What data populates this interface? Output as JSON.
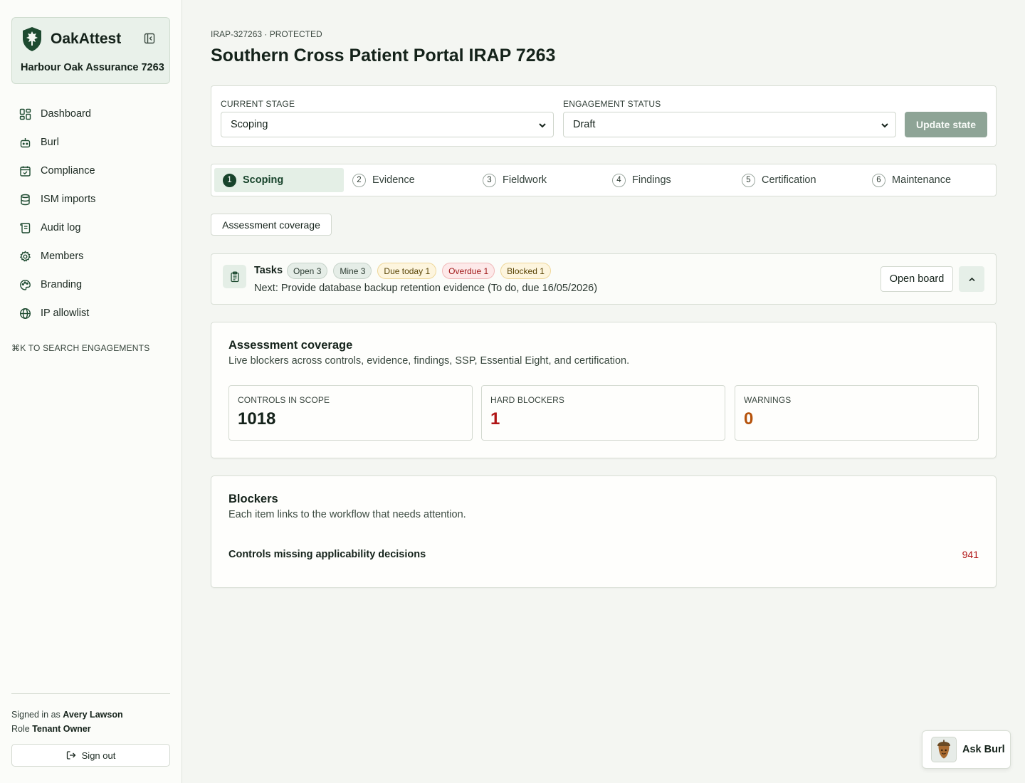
{
  "brand": {
    "name": "OakAttest",
    "tenant": "Harbour Oak Assurance 7263"
  },
  "nav": [
    {
      "label": "Dashboard",
      "icon": "dashboard-icon"
    },
    {
      "label": "Burl",
      "icon": "bot-icon"
    },
    {
      "label": "Compliance",
      "icon": "calendar-check-icon"
    },
    {
      "label": "ISM imports",
      "icon": "database-icon"
    },
    {
      "label": "Audit log",
      "icon": "scroll-icon"
    },
    {
      "label": "Members",
      "icon": "gear-icon"
    },
    {
      "label": "Branding",
      "icon": "palette-icon"
    },
    {
      "label": "IP allowlist",
      "icon": "globe-icon"
    }
  ],
  "search_hint": "⌘K TO SEARCH ENGAGEMENTS",
  "user": {
    "signed_in_prefix": "Signed in as",
    "name": "Avery Lawson",
    "role_prefix": "Role",
    "role": "Tenant Owner",
    "sign_out": "Sign out"
  },
  "header": {
    "eyebrow": "IRAP-327263 · PROTECTED",
    "title": "Southern Cross Patient Portal IRAP 7263"
  },
  "state": {
    "stage_label": "CURRENT STAGE",
    "stage_value": "Scoping",
    "status_label": "ENGAGEMENT STATUS",
    "status_value": "Draft",
    "update_button": "Update state"
  },
  "stages": [
    {
      "num": "1",
      "label": "Scoping",
      "active": true
    },
    {
      "num": "2",
      "label": "Evidence",
      "active": false
    },
    {
      "num": "3",
      "label": "Fieldwork",
      "active": false
    },
    {
      "num": "4",
      "label": "Findings",
      "active": false
    },
    {
      "num": "5",
      "label": "Certification",
      "active": false
    },
    {
      "num": "6",
      "label": "Maintenance",
      "active": false
    }
  ],
  "coverage_tab": "Assessment coverage",
  "tasks": {
    "title": "Tasks",
    "badges": [
      {
        "label": "Open 3",
        "kind": "neutral"
      },
      {
        "label": "Mine 3",
        "kind": "neutral"
      },
      {
        "label": "Due today 1",
        "kind": "due"
      },
      {
        "label": "Overdue 1",
        "kind": "overdue"
      },
      {
        "label": "Blocked 1",
        "kind": "blocked"
      }
    ],
    "next": "Next: Provide database backup retention evidence (To do, due 16/05/2026)",
    "open_board": "Open board"
  },
  "coverage": {
    "title": "Assessment coverage",
    "subtitle": "Live blockers across controls, evidence, findings, SSP, Essential Eight, and certification.",
    "stats": [
      {
        "label": "CONTROLS IN SCOPE",
        "value": "1018",
        "color": "#14221a"
      },
      {
        "label": "HARD BLOCKERS",
        "value": "1",
        "color": "#b01414"
      },
      {
        "label": "WARNINGS",
        "value": "0",
        "color": "#b5520b"
      }
    ]
  },
  "blockers": {
    "title": "Blockers",
    "subtitle": "Each item links to the workflow that needs attention.",
    "items": [
      {
        "label": "Controls missing applicability decisions",
        "count": "941"
      }
    ]
  },
  "assistant": {
    "label": "Ask Burl"
  },
  "colors": {
    "accent": "#17432b",
    "sidebar_bg": "#fbfcf9",
    "page_bg": "#f4f6f2",
    "danger": "#b01414",
    "warning": "#b5520b"
  }
}
